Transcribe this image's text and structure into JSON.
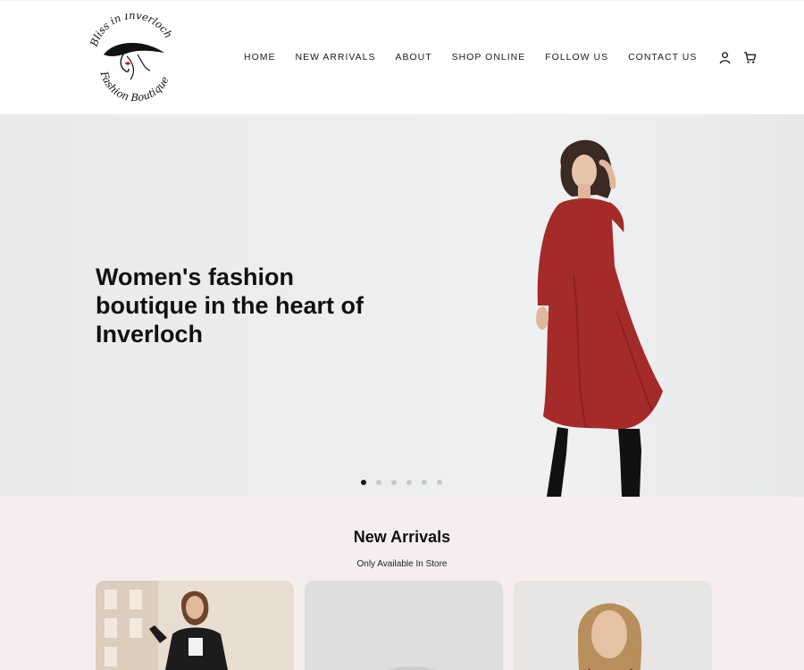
{
  "header": {
    "logo_text": [
      "Bliss in Inverloch",
      "Fashion Boutique"
    ],
    "nav": [
      "HOME",
      "NEW ARRIVALS",
      "ABOUT",
      "SHOP ONLINE",
      "FOLLOW US",
      "CONTACT US"
    ],
    "icons": [
      "user-icon",
      "cart-icon"
    ]
  },
  "hero": {
    "headline": "Women's fashion boutique in the heart of Inverloch",
    "slide_count": 6,
    "active_slide": 1,
    "colors": {
      "dress": "#a52a2a",
      "background": "#eceef0"
    }
  },
  "arrivals": {
    "title": "New Arrivals",
    "subtitle": "Only Available In Store",
    "section_bg": "#f6eeee"
  }
}
